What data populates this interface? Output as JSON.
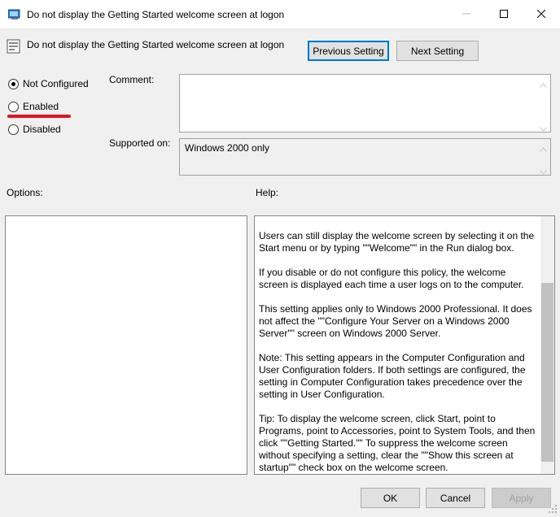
{
  "window": {
    "title": "Do not display the Getting Started welcome screen at logon"
  },
  "header": {
    "policy_name": "Do not display the Getting Started welcome screen at logon",
    "previous_label": "Previous Setting",
    "next_label": "Next Setting"
  },
  "state": {
    "options": [
      {
        "label": "Not Configured",
        "checked": true
      },
      {
        "label": "Enabled",
        "checked": false
      },
      {
        "label": "Disabled",
        "checked": false
      }
    ]
  },
  "comment": {
    "label": "Comment:",
    "value": ""
  },
  "supported": {
    "label": "Supported on:",
    "value": "Windows 2000 only"
  },
  "options_panel": {
    "label": "Options:"
  },
  "help_panel": {
    "label": "Help:",
    "paragraphs": [
      "Users can still display the welcome screen by selecting it on the Start menu or by typing \"\"Welcome\"\" in the Run dialog box.",
      "If you disable or do not configure this policy, the welcome screen is displayed each time a user logs on to the computer.",
      "This setting applies only to Windows 2000 Professional. It does not affect the \"\"Configure Your Server on a Windows 2000 Server\"\" screen on Windows 2000 Server.",
      "Note: This setting appears in the Computer Configuration and User Configuration folders. If both settings are configured, the setting in Computer Configuration takes precedence over the setting in User Configuration.",
      "Tip: To display the welcome screen, click Start, point to Programs, point to Accessories, point to System Tools, and then click \"\"Getting Started.\"\" To suppress the welcome screen without specifying a setting, clear the \"\"Show this screen at startup\"\" check box on the welcome screen."
    ]
  },
  "footer": {
    "ok_label": "OK",
    "cancel_label": "Cancel",
    "apply_label": "Apply"
  },
  "colors": {
    "accent": "#0078d7",
    "annotation": "#e81123"
  }
}
